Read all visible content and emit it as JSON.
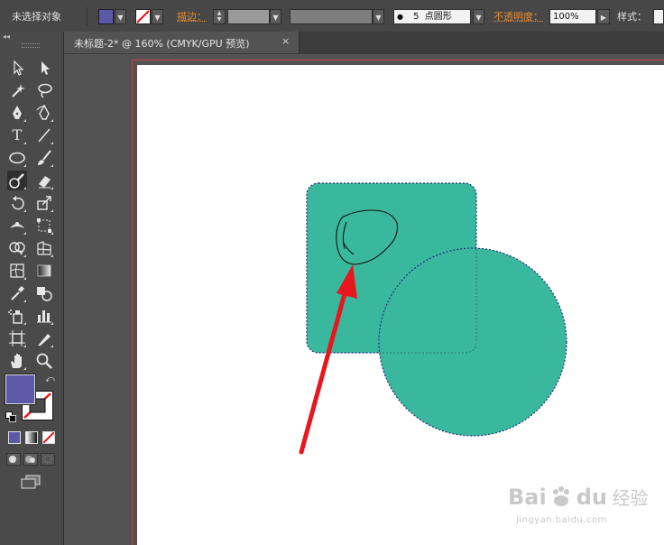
{
  "control_bar": {
    "selection_label": "未选择对象",
    "fill_color": "#5c5aa8",
    "stroke_label": "描边：",
    "brush_dot": "●",
    "brush_size": "5",
    "brush_shape": "点圆形",
    "opacity_label": "不透明度：",
    "opacity_value": "100%",
    "style_label": "样式："
  },
  "document_tab": {
    "title": "未标题-2* @ 160% (CMYK/GPU 预览)",
    "close": "×"
  },
  "toolbar": {
    "collapse": "◂◂",
    "fill_color": "#5c5aa8"
  },
  "canvas": {
    "shape_fill": "#3ab89d",
    "arrow_color": "#e8161d"
  },
  "watermark": {
    "brand": "Bai",
    "brand2": "du",
    "cn": "经验",
    "url": "jingyan.baidu.com"
  }
}
